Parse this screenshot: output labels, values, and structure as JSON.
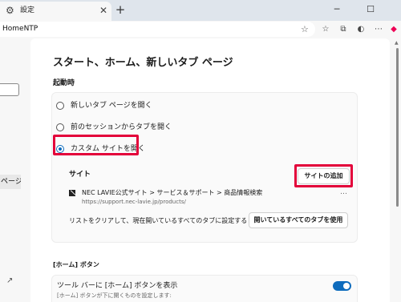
{
  "tab": {
    "title": "設定",
    "icon": "gear-icon"
  },
  "window": {
    "minimize": "─",
    "maximize": "☐",
    "new_tab": "+"
  },
  "address": {
    "url": "HomeNTP"
  },
  "sidebar": {
    "item_label": "ページ"
  },
  "page": {
    "title": "スタート、ホーム、新しいタブ ページ",
    "startup_heading": "起動時",
    "options": [
      {
        "label": "新しいタブ ページを開く",
        "selected": false
      },
      {
        "label": "前のセッションからタブを開く",
        "selected": false
      },
      {
        "label": "カスタム サイトを開く",
        "selected": true
      }
    ],
    "sites_heading": "サイト",
    "add_site_label": "サイトの追加",
    "site": {
      "title": "NEC LAVIE公式サイト > サービス＆サポート > 商品情報検索",
      "url": "https://support.nec-lavie.jp/products/",
      "more": "…"
    },
    "clear_text": "リストをクリアして、現在開いているすべてのタブに設定する",
    "use_tabs_label": "開いているすべてのタブを使用",
    "home_heading": "[ホーム] ボタン",
    "toolbar_label": "ツール バーに [ホーム] ボタンを表示",
    "toolbar_sub": "[ホーム] ボタンが下に開くものを設定します:",
    "toolbar_toggle_on": true
  },
  "colors": {
    "accent": "#0f6cbd",
    "highlight": "#e3003a"
  }
}
